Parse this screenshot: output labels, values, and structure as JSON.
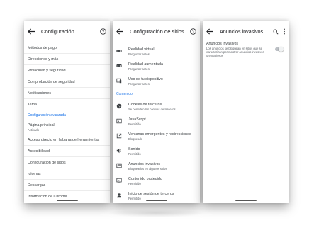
{
  "screens": [
    {
      "title": "Configuración",
      "items": [
        "Métodos de pago",
        "Direcciones y más",
        "Privacidad y seguridad",
        "Comprobación de seguridad",
        "Notificaciones",
        "Tema"
      ],
      "section_label": "Configuración avanzada",
      "homepage": {
        "title": "Página principal",
        "subtitle": "Activado"
      },
      "advanced_items": [
        "Acceso directo en la barra de herramientas",
        "Accesibilidad",
        "Configuración de sitios",
        "Idiomas",
        "Descargas",
        "Información de Chrome"
      ]
    },
    {
      "title": "Configuración de sitios",
      "partial_top": "Preguntar antes",
      "items": [
        {
          "icon": "vr-headset-icon",
          "title": "Realidad virtual",
          "subtitle": "Preguntar antes"
        },
        {
          "icon": "ar-headset-icon",
          "title": "Realidad aumentada",
          "subtitle": "Preguntar antes"
        },
        {
          "icon": "device-usage-icon",
          "title": "Uso de tu dispositivo",
          "subtitle": "Preguntar antes"
        }
      ],
      "section_label": "Contenido",
      "content_items": [
        {
          "icon": "cookie-icon",
          "title": "Cookies de terceros",
          "subtitle": "Se permiten las cookies de terceros"
        },
        {
          "icon": "javascript-icon",
          "title": "JavaScript",
          "subtitle": "Permitido"
        },
        {
          "icon": "popup-icon",
          "title": "Ventanas emergentes y redirecciones",
          "subtitle": "Bloqueado"
        },
        {
          "icon": "sound-icon",
          "title": "Sonido",
          "subtitle": "Permitido"
        },
        {
          "icon": "ads-icon",
          "title": "Anuncios invasivos",
          "subtitle": "Bloqueados en algunos sitios"
        },
        {
          "icon": "protected-content-icon",
          "title": "Contenido protegido",
          "subtitle": "Permitido"
        },
        {
          "icon": "signin-icon",
          "title": "Inicio de sesión de terceros",
          "subtitle": "Permitido"
        }
      ]
    },
    {
      "title": "Anuncios invasivos",
      "setting_title": "Anuncios invasivos",
      "setting_desc": "Los anuncios se bloquean en sitios que se caracterizan por mostrar anuncios invasivos o engañosos",
      "toggle_on": false
    }
  ],
  "colors": {
    "accent": "#1a73e8",
    "text": "#3c4043",
    "subtext": "#5f6368"
  }
}
